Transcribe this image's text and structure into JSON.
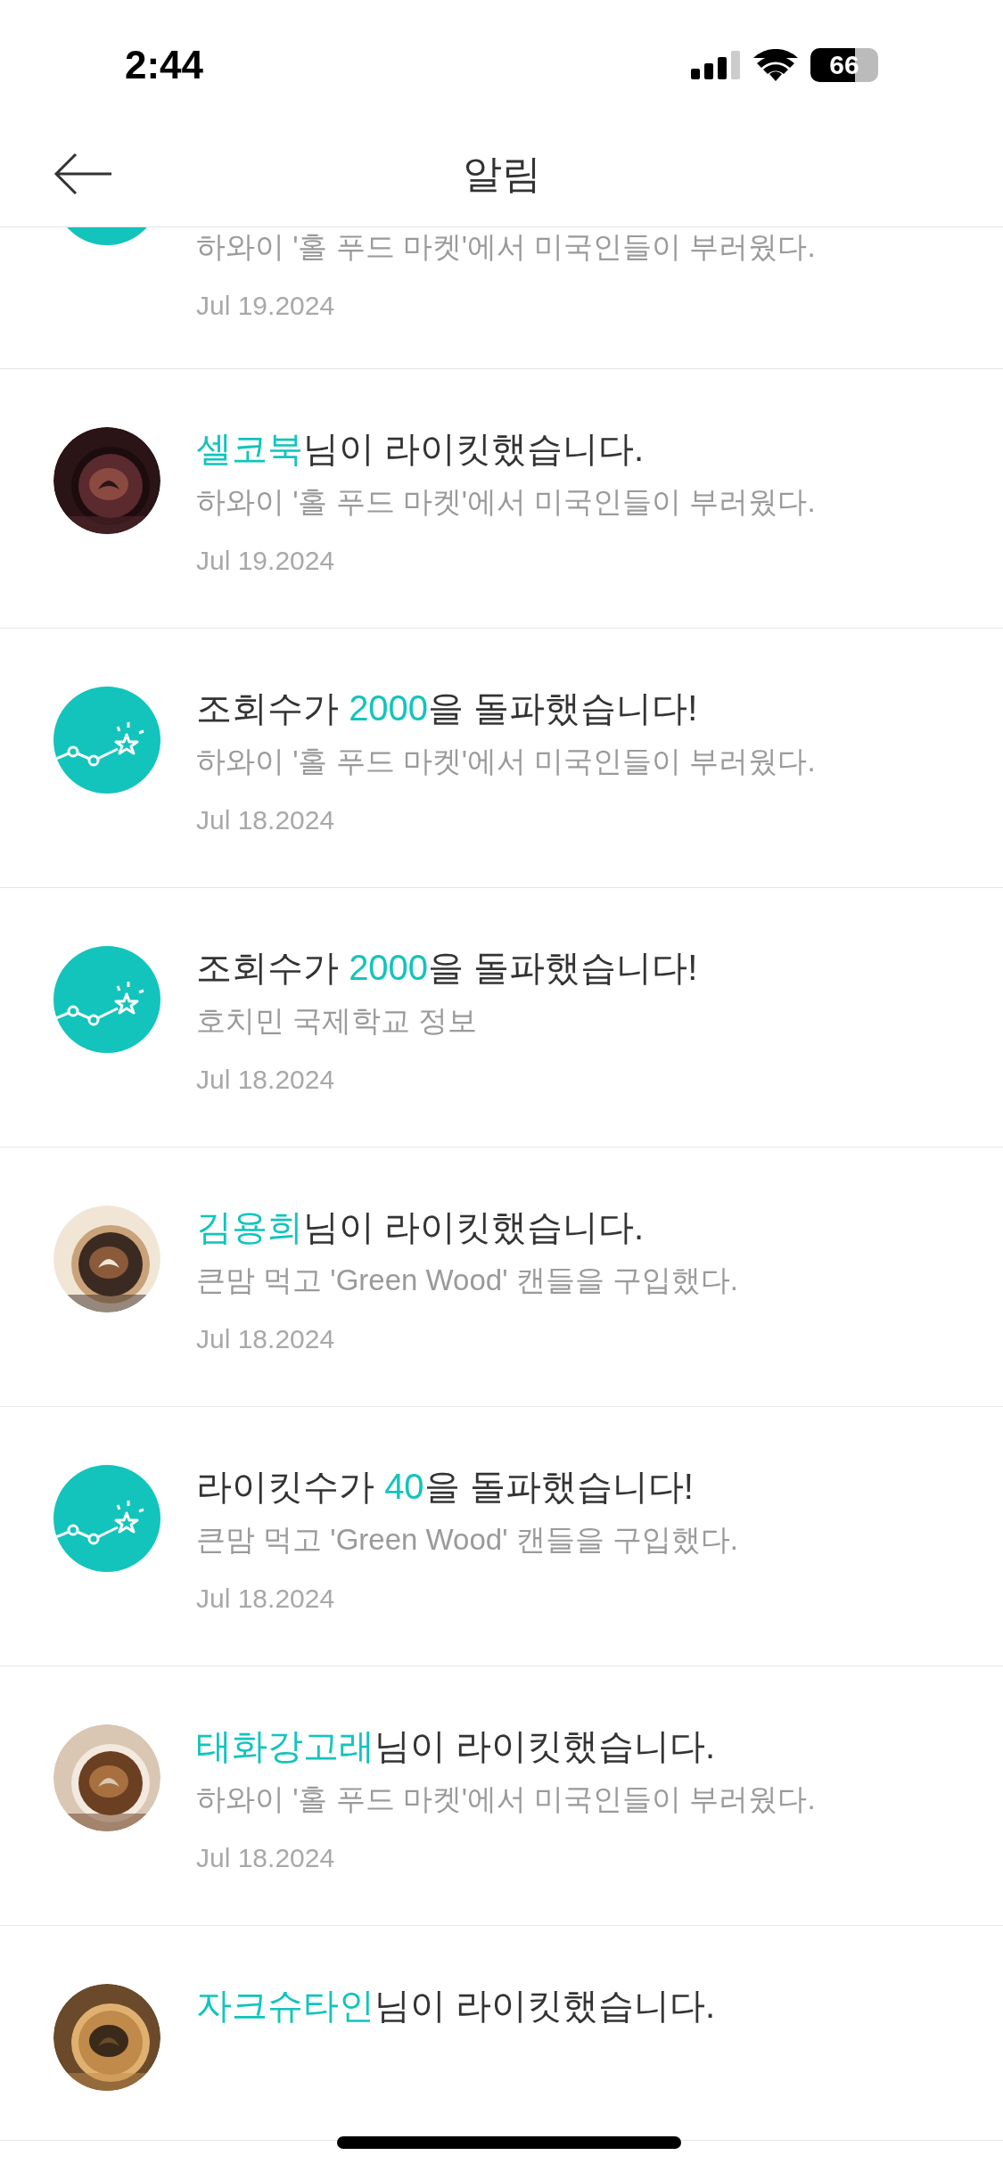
{
  "status_bar": {
    "time": "2:44",
    "battery": "66"
  },
  "header": {
    "title": "알림"
  },
  "notifications": [
    {
      "kind": "milestone",
      "subtitle": "하와이 '홀 푸드 마켓'에서 미국인들이 부러웠다.",
      "date": "Jul 19.2024"
    },
    {
      "kind": "like",
      "highlight": "셀코북",
      "rest": "님이 라이킷했습니다.",
      "subtitle": "하와이 '홀 푸드 마켓'에서 미국인들이 부러웠다.",
      "date": "Jul 19.2024"
    },
    {
      "kind": "milestone",
      "prefix": "조회수가 ",
      "highlight": "2000",
      "rest": "을 돌파했습니다!",
      "subtitle": "하와이 '홀 푸드 마켓'에서 미국인들이 부러웠다.",
      "date": "Jul 18.2024"
    },
    {
      "kind": "milestone",
      "prefix": "조회수가 ",
      "highlight": "2000",
      "rest": "을 돌파했습니다!",
      "subtitle": "호치민 국제학교 정보",
      "date": "Jul 18.2024"
    },
    {
      "kind": "like",
      "highlight": "김용희",
      "rest": "님이 라이킷했습니다.",
      "subtitle": "큰맘 먹고 'Green Wood' 캔들을 구입했다.",
      "date": "Jul 18.2024"
    },
    {
      "kind": "milestone",
      "prefix": "라이킷수가 ",
      "highlight": "40",
      "rest": "을 돌파했습니다!",
      "subtitle": "큰맘 먹고 'Green Wood' 캔들을 구입했다.",
      "date": "Jul 18.2024"
    },
    {
      "kind": "like",
      "highlight": "태화강고래",
      "rest": "님이 라이킷했습니다.",
      "subtitle": "하와이 '홀 푸드 마켓'에서 미국인들이 부러웠다.",
      "date": "Jul 18.2024"
    },
    {
      "kind": "like",
      "highlight": "자크슈타인",
      "rest": "님이 라이킷했습니다."
    }
  ]
}
